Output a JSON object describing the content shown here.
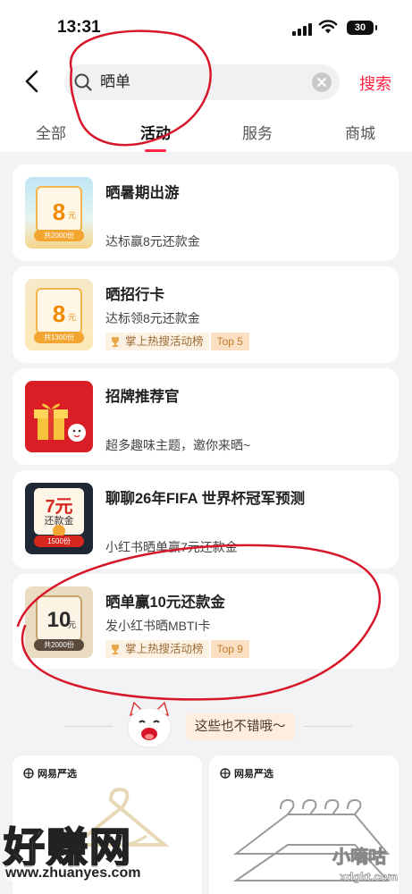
{
  "status_bar": {
    "time": "13:31",
    "battery": "30"
  },
  "search": {
    "query": "晒单",
    "button_label": "搜索"
  },
  "tabs": [
    {
      "label": "全部"
    },
    {
      "label": "活动"
    },
    {
      "label": "服务"
    },
    {
      "label": "商城"
    }
  ],
  "active_tab": "活动",
  "activities": [
    {
      "title": "晒暑期出游",
      "subtitle": "达标赢8元还款金",
      "thumb_amount": "8",
      "thumb_unit": "元",
      "thumb_footer": "共2000份"
    },
    {
      "title": "晒招行卡",
      "subtitle": "达标领8元还款金",
      "badge": "掌上热搜活动榜",
      "rank": "Top 5",
      "thumb_amount": "8",
      "thumb_unit": "元",
      "thumb_footer": "共1300份"
    },
    {
      "title": "招牌推荐官",
      "subtitle": "超多趣味主题，邀你来晒~"
    },
    {
      "title": "聊聊26年FIFA 世界杯冠军预测",
      "subtitle": "小红书晒单赢7元还款金",
      "thumb_amount": "7元",
      "thumb_label": "还款金",
      "thumb_footer": "1500份"
    },
    {
      "title": "晒单赢10元还款金",
      "subtitle": "发小红书晒MBTI卡",
      "badge": "掌上热搜活动榜",
      "rank": "Top 9",
      "thumb_amount": "10",
      "thumb_unit": "元",
      "thumb_footer": "共2000份"
    }
  ],
  "recommend": {
    "label": "这些也不错哦～"
  },
  "products": [
    {
      "brand": "网易严选"
    },
    {
      "brand": "网易严选"
    }
  ],
  "watermarks": {
    "site_cn": "好赚网",
    "site_url": "www.zhuanyes.com",
    "right_cn": "小嘀咕",
    "right_url": "xdgkt.com"
  },
  "colors": {
    "accent": "#ff2442",
    "badge_text": "#9a6a33",
    "annotation": "#d8162a"
  }
}
